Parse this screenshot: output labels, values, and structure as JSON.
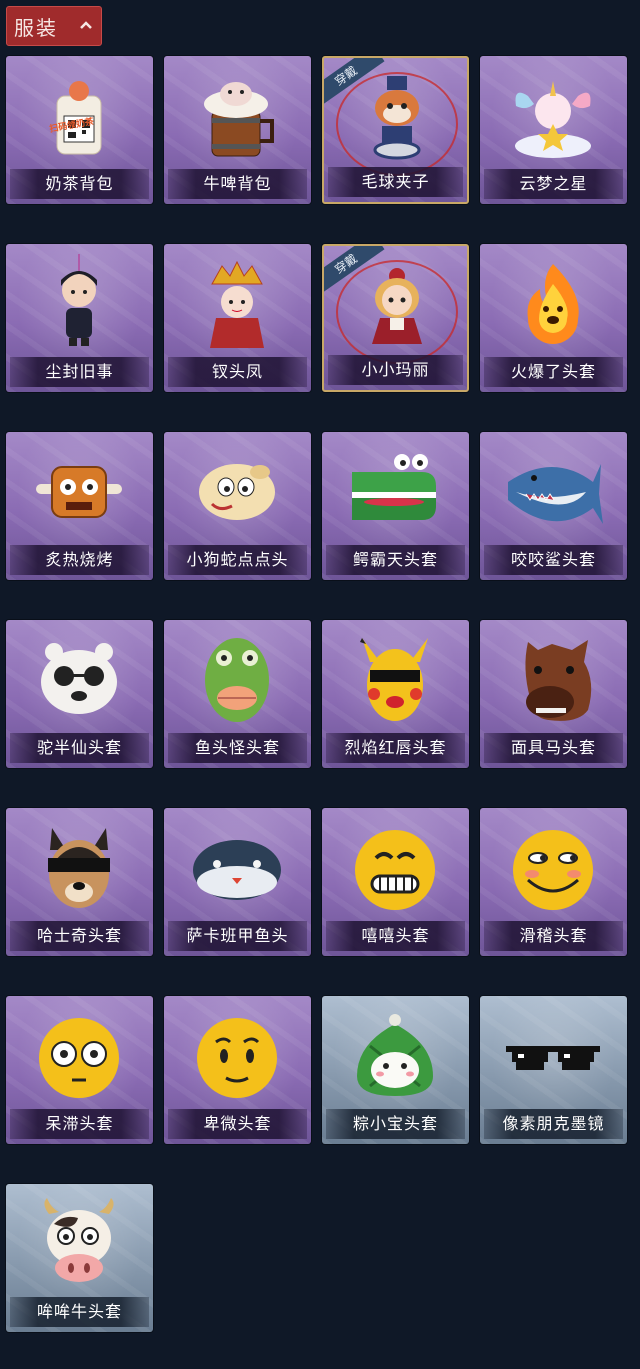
{
  "header": {
    "title": "服装"
  },
  "colors": {
    "background": "#0f1827",
    "card_purple": "#8a6bb3",
    "card_blue": "#8799ad",
    "header_red": "#a02b2c",
    "worn_tag": "#2f4a6b"
  },
  "items": [
    {
      "label": "奶茶背包",
      "variant": "purple",
      "worn": false,
      "icon": "milk-tea-backpack-icon",
      "badge": "扫码领奶茶"
    },
    {
      "label": "牛啤背包",
      "variant": "purple",
      "worn": false,
      "icon": "beer-barrel-backpack-icon"
    },
    {
      "label": "毛球夹子",
      "variant": "purple",
      "worn": true,
      "tag": "穿戴",
      "icon": "raccoon-drummer-clip-icon"
    },
    {
      "label": "云梦之星",
      "variant": "purple",
      "worn": false,
      "icon": "unicorn-cloud-star-icon"
    },
    {
      "label": "尘封旧事",
      "variant": "purple",
      "worn": false,
      "icon": "chibi-man-pendant-icon"
    },
    {
      "label": "钗头凤",
      "variant": "purple",
      "worn": false,
      "icon": "phoenix-crown-doll-icon"
    },
    {
      "label": "小小玛丽",
      "variant": "purple",
      "worn": true,
      "tag": "穿戴",
      "icon": "little-mary-doll-icon"
    },
    {
      "label": "火爆了头套",
      "variant": "purple",
      "worn": false,
      "icon": "fire-head-mask-icon"
    },
    {
      "label": "炙热烧烤",
      "variant": "purple",
      "worn": false,
      "icon": "bbq-meat-mask-icon"
    },
    {
      "label": "小狗蛇点点头",
      "variant": "purple",
      "worn": false,
      "icon": "dog-snake-mask-icon"
    },
    {
      "label": "鳄霸天头套",
      "variant": "purple",
      "worn": false,
      "icon": "crocodile-mask-icon"
    },
    {
      "label": "咬咬鲨头套",
      "variant": "purple",
      "worn": false,
      "icon": "shark-mask-icon"
    },
    {
      "label": "驼半仙头套",
      "variant": "purple",
      "worn": false,
      "icon": "polar-bear-sunglasses-mask-icon"
    },
    {
      "label": "鱼头怪头套",
      "variant": "purple",
      "worn": false,
      "icon": "fish-head-mask-icon"
    },
    {
      "label": "烈焰红唇头套",
      "variant": "purple",
      "worn": false,
      "icon": "yellow-pikachu-lips-mask-icon"
    },
    {
      "label": "面具马头套",
      "variant": "purple",
      "worn": false,
      "icon": "horse-head-mask-icon"
    },
    {
      "label": "哈士奇头套",
      "variant": "purple",
      "worn": false,
      "icon": "husky-sunglasses-mask-icon"
    },
    {
      "label": "萨卡班甲鱼头",
      "variant": "purple",
      "worn": false,
      "icon": "sacabambaspis-fish-mask-icon"
    },
    {
      "label": "嘻嘻头套",
      "variant": "purple",
      "worn": false,
      "icon": "grinning-emoji-mask-icon"
    },
    {
      "label": "滑稽头套",
      "variant": "purple",
      "worn": false,
      "icon": "funny-emoji-mask-icon"
    },
    {
      "label": "呆滞头套",
      "variant": "purple",
      "worn": false,
      "icon": "dazed-emoji-mask-icon"
    },
    {
      "label": "卑微头套",
      "variant": "purple",
      "worn": false,
      "icon": "humble-emoji-mask-icon"
    },
    {
      "label": "粽小宝头套",
      "variant": "blue",
      "worn": false,
      "icon": "zongzi-mask-icon"
    },
    {
      "label": "像素朋克墨镜",
      "variant": "blue",
      "worn": false,
      "icon": "pixel-sunglasses-icon"
    },
    {
      "label": "哞哞牛头套",
      "variant": "blue",
      "worn": false,
      "icon": "cow-head-mask-icon"
    }
  ]
}
